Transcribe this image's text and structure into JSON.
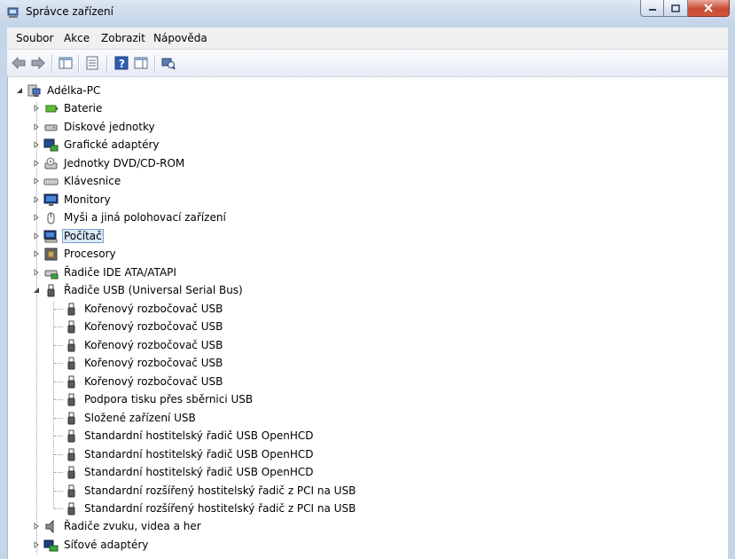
{
  "window": {
    "title": "Správce zařízení"
  },
  "menu": [
    "Soubor",
    "Akce",
    "Zobrazit",
    "Nápověda"
  ],
  "tree": {
    "root": "Adélka-PC",
    "categories": [
      "Baterie",
      "Diskové jednotky",
      "Grafické adaptéry",
      "Jednotky DVD/CD-ROM",
      "Klávesnice",
      "Monitory",
      "Myši a jiná polohovací zařízení",
      "Počítač",
      "Procesory",
      "Řadiče IDE ATA/ATAPI",
      "Řadiče USB (Universal Serial Bus)",
      "Řadiče zvuku, videa a her",
      "Síťové adaptéry"
    ],
    "usb_children": [
      "Kořenový rozbočovač USB",
      "Kořenový rozbočovač USB",
      "Kořenový rozbočovač USB",
      "Kořenový rozbočovač USB",
      "Kořenový rozbočovač USB",
      "Podpora tisku přes sběrnici USB",
      "Složené zařízení USB",
      "Standardní hostitelský řadič  USB OpenHCD",
      "Standardní hostitelský řadič  USB OpenHCD",
      "Standardní hostitelský řadič  USB OpenHCD",
      "Standardní rozšířený hostitelský řadič z PCI na USB",
      "Standardní rozšířený hostitelský řadič z PCI na USB"
    ]
  },
  "colors": {
    "selection": "#d9e8fb",
    "titlebar": "#cfdcec"
  }
}
